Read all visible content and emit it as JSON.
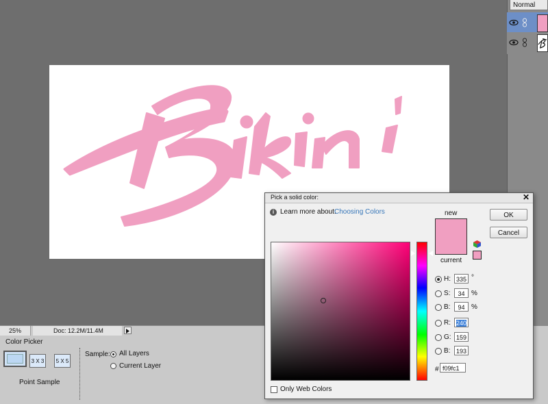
{
  "layers_panel": {
    "blend_mode": "Normal"
  },
  "canvas": {
    "artwork_text": "Bikini",
    "artwork_color": "#f09fc1"
  },
  "status_bar": {
    "zoom": "25%",
    "doc_info": "Doc: 12.2M/11.4M"
  },
  "tool_options": {
    "title": "Color Picker",
    "point_sample_label": "Point Sample",
    "btn_3x3": "3 X 3",
    "btn_5x5": "5 X 5",
    "sample_label": "Sample:",
    "all_layers": "All Layers",
    "current_layer": "Current Layer",
    "selected_sample": "All Layers"
  },
  "color_dialog": {
    "title": "Pick a solid color:",
    "learn_more": "Learn more about:",
    "learn_link": "Choosing Colors",
    "new_label": "new",
    "current_label": "current",
    "ok": "OK",
    "cancel": "Cancel",
    "h_label": "H:",
    "h_value": "335",
    "h_unit": "°",
    "s_label": "S:",
    "s_value": "34",
    "s_unit": "%",
    "b_label": "B:",
    "b_value": "94",
    "b_unit": "%",
    "r_label": "R:",
    "r_value": "240",
    "g_label": "G:",
    "g_value": "159",
    "b2_label": "B:",
    "b2_value": "193",
    "hash": "#",
    "hex_value": "f09fc1",
    "only_web_colors": "Only Web Colors",
    "selected_field": "H",
    "new_color": "#f09fc1",
    "current_color": "#f09fc1"
  }
}
